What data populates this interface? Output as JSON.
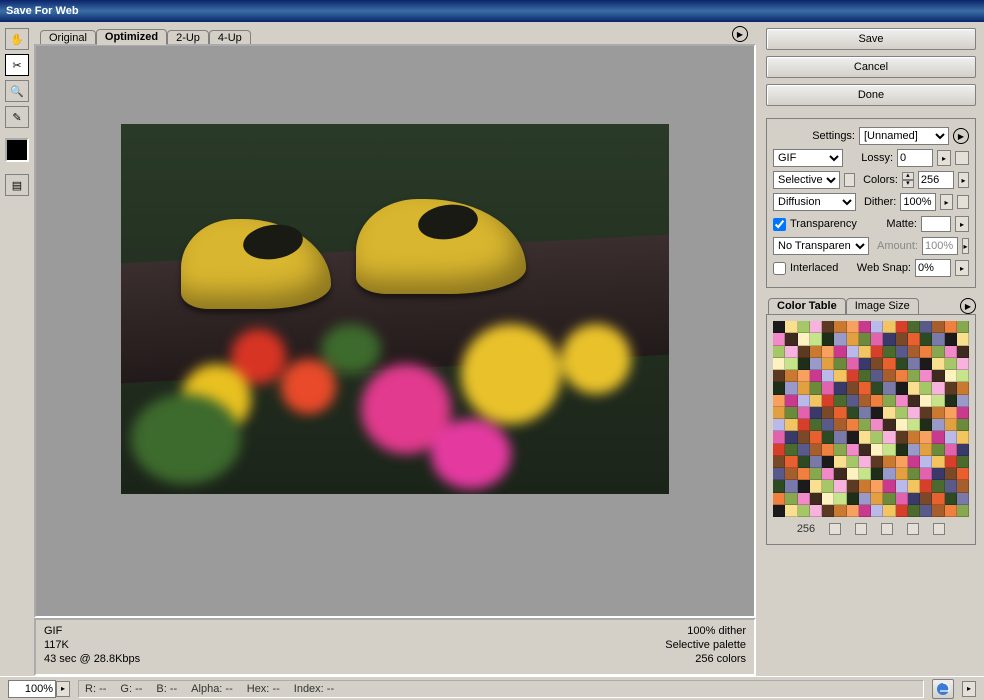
{
  "window": {
    "title": "Save For Web"
  },
  "tabs": [
    "Original",
    "Optimized",
    "2-Up",
    "4-Up"
  ],
  "tabs_active": 1,
  "buttons": {
    "save": "Save",
    "cancel": "Cancel",
    "done": "Done"
  },
  "settings": {
    "label": "Settings:",
    "preset": "[Unnamed]",
    "format": "GIF",
    "lossy_label": "Lossy:",
    "lossy": "0",
    "reduction": "Selective",
    "colors_label": "Colors:",
    "colors": "256",
    "dither_method": "Diffusion",
    "dither_label": "Dither:",
    "dither": "100%",
    "transparency_label": "Transparency",
    "transparency_checked": true,
    "matte_label": "Matte:",
    "trans_dither": "No Transparen…",
    "amount_label": "Amount:",
    "amount": "100%",
    "interlaced_label": "Interlaced",
    "interlaced_checked": false,
    "websnap_label": "Web Snap:",
    "websnap": "0%"
  },
  "color_table": {
    "tabs": [
      "Color Table",
      "Image Size"
    ],
    "active": 0,
    "count": "256"
  },
  "info": {
    "format": "GIF",
    "size": "117K",
    "time": "43 sec @ 28.8Kbps",
    "dither": "100% dither",
    "palette": "Selective palette",
    "colors": "256 colors"
  },
  "footer": {
    "zoom": "100%",
    "R": "--",
    "G": "--",
    "B": "--",
    "Alpha": "--",
    "Hex": "--",
    "Index": "--"
  },
  "tools": [
    "hand",
    "slice-select",
    "zoom",
    "eyedropper"
  ]
}
